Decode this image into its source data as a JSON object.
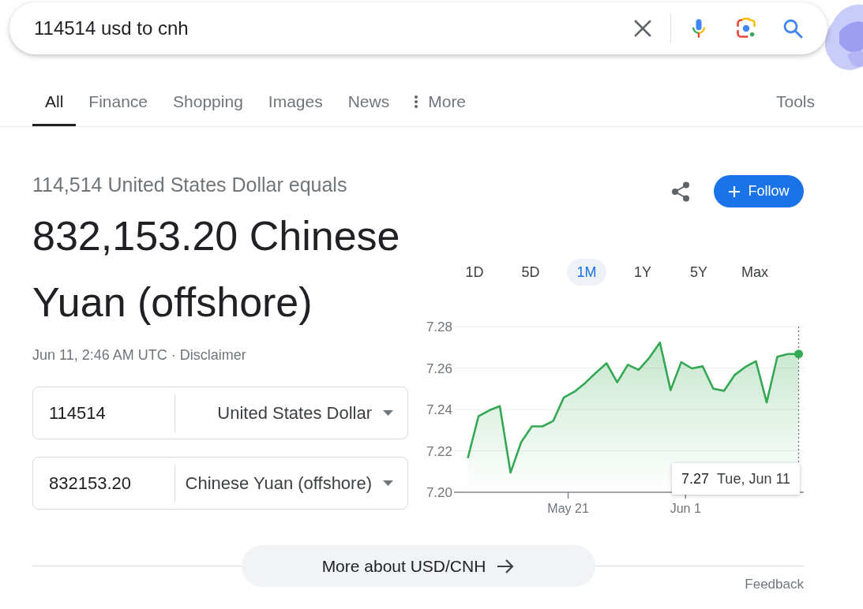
{
  "search": {
    "query": "114514 usd to cnh"
  },
  "tabs": [
    {
      "label": "All",
      "selected": true,
      "kind": "link"
    },
    {
      "label": "Finance",
      "selected": false,
      "kind": "link"
    },
    {
      "label": "Shopping",
      "selected": false,
      "kind": "link"
    },
    {
      "label": "Images",
      "selected": false,
      "kind": "link"
    },
    {
      "label": "News",
      "selected": false,
      "kind": "link"
    },
    {
      "label": "More",
      "selected": false,
      "kind": "menu"
    }
  ],
  "tools": "Tools",
  "result": {
    "summary": "114,514 United States Dollar equals",
    "amount": "832,153.20 Chinese Yuan (offshore)",
    "timestamp": "Jun 11, 2:46 AM UTC ·",
    "disclaimer": "Disclaimer"
  },
  "converter": [
    {
      "amount": "114514",
      "currency": "United States Dollar"
    },
    {
      "amount": "832153.20",
      "currency": "Chinese Yuan (offshore)"
    }
  ],
  "follow_button": "Follow",
  "chart": {
    "ranges": [
      {
        "label": "1D",
        "selected": false
      },
      {
        "label": "5D",
        "selected": false
      },
      {
        "label": "1M",
        "selected": true
      },
      {
        "label": "1Y",
        "selected": false
      },
      {
        "label": "5Y",
        "selected": false
      },
      {
        "label": "Max",
        "selected": false
      }
    ],
    "chart_data": {
      "type": "area",
      "categories": [
        null,
        null,
        null,
        null,
        null,
        null,
        null,
        null,
        null,
        "May 21",
        null,
        null,
        null,
        null,
        null,
        null,
        null,
        null,
        null,
        null,
        "Jun 1",
        null,
        null,
        null,
        null,
        null,
        null,
        null,
        null,
        null,
        null,
        null
      ],
      "series": [
        {
          "color": "#34a853",
          "values": [
            7.2165,
            7.2367,
            7.2395,
            7.2416,
            7.2095,
            7.2242,
            7.2318,
            7.2318,
            7.2344,
            7.2458,
            7.2486,
            7.2528,
            7.2577,
            7.2623,
            7.2531,
            7.2616,
            7.2591,
            7.2649,
            7.2723,
            7.2493,
            7.2628,
            7.2598,
            7.2608,
            7.25,
            7.249,
            7.2566,
            7.2605,
            7.2633,
            7.2434,
            7.2654,
            7.2668,
            7.2668
          ]
        }
      ],
      "ylim": [
        7.2,
        7.28
      ],
      "yticks": [
        {
          "value": 7.28,
          "label": "7.28"
        },
        {
          "value": 7.26,
          "label": "7.26"
        },
        {
          "value": 7.24,
          "label": "7.24"
        },
        {
          "value": 7.22,
          "label": "7.22"
        },
        {
          "value": 7.2,
          "label": "7.20"
        }
      ],
      "grid": true
    },
    "tooltip": {
      "value": "7.27",
      "date": "Tue, Jun 11"
    }
  },
  "more_button": "More about USD/CNH",
  "feedback": "Feedback"
}
